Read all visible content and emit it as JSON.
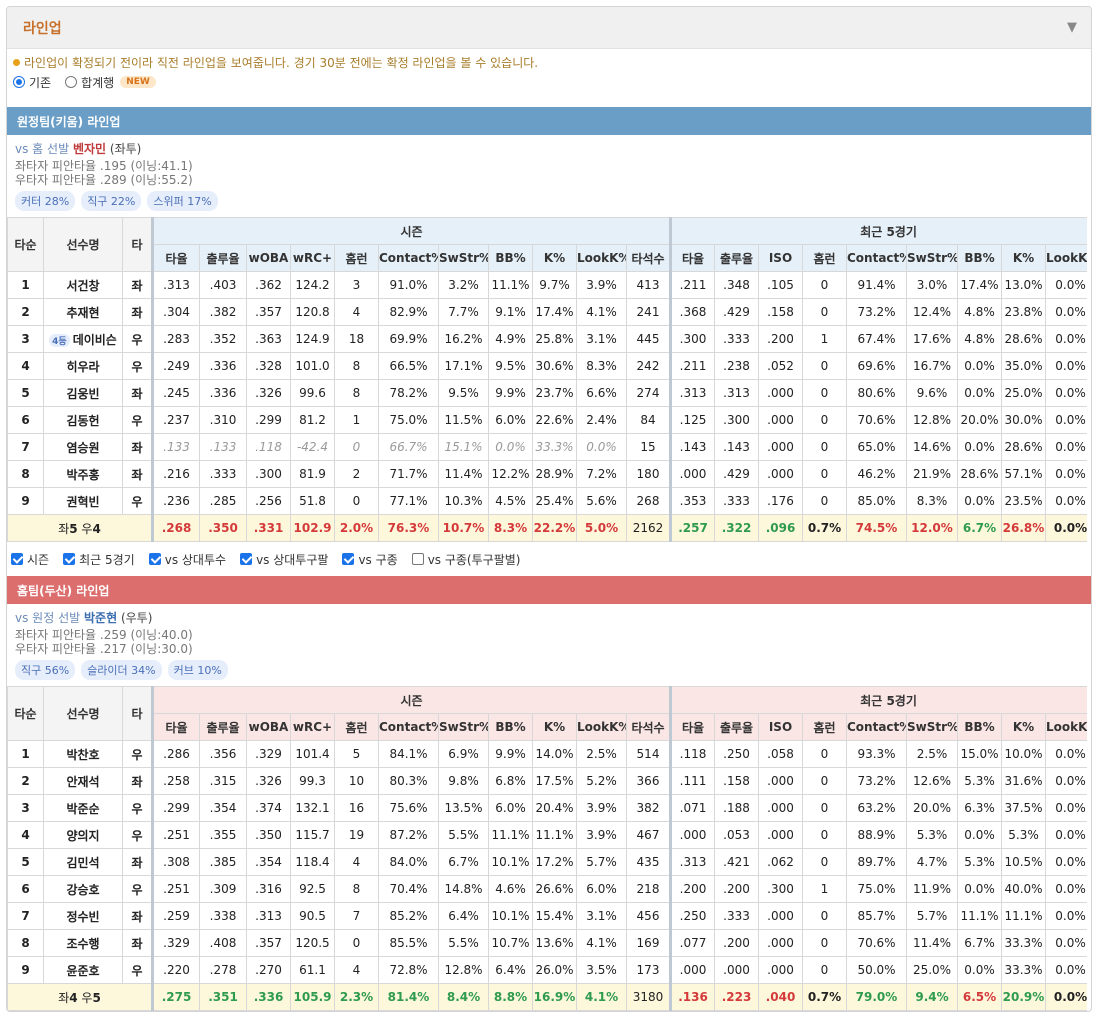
{
  "title": "라인업",
  "notice": "라인업이 확정되기 전이라 직전 라인업을 보여줍니다. 경기 30분 전에는 확정 라인업을 볼 수 있습니다.",
  "view_options": [
    {
      "label": "기존",
      "selected": true
    },
    {
      "label": "합계행",
      "selected": false
    }
  ],
  "new_badge": "NEW",
  "filters": [
    {
      "label": "시즌",
      "checked": true
    },
    {
      "label": "최근 5경기",
      "checked": true
    },
    {
      "label": "vs 상대투수",
      "checked": true
    },
    {
      "label": "vs 상대투구팔",
      "checked": true
    },
    {
      "label": "vs 구종",
      "checked": true
    },
    {
      "label": "vs 구종(투구팔별)",
      "checked": false
    }
  ],
  "headers": {
    "order": "타순",
    "name": "선수명",
    "hand": "타",
    "season": "시즌",
    "recent": "최근 5경기",
    "season_cols": [
      "타율",
      "출루율",
      "wOBA",
      "wRC+",
      "홈런",
      "Contact%",
      "SwStr%",
      "BB%",
      "K%",
      "LookK%",
      "타석수"
    ],
    "recent_cols": [
      "타율",
      "출루율",
      "ISO",
      "홈런",
      "Contact%",
      "SwStr%",
      "BB%",
      "K%",
      "LookK%"
    ]
  },
  "away": {
    "header": "원정팀(키움) 라인업",
    "vs_prefix": "vs 홈 선발",
    "pitcher": "벤자민",
    "pitcher_hand": "(좌투)",
    "vs_left": "좌타자 피안타율 .195 (이닝:41.1)",
    "vs_right": "우타자 피안타율 .289 (이닝:55.2)",
    "pitches": [
      "커터 28%",
      "직구 22%",
      "스위퍼 17%"
    ],
    "rows": [
      {
        "order": "1",
        "name": "서건창",
        "badge": "",
        "hand": "좌",
        "dim": false,
        "s": [
          ".313",
          ".403",
          ".362",
          "124.2",
          "3",
          "91.0%",
          "3.2%",
          "11.1%",
          "9.7%",
          "3.9%",
          "413"
        ],
        "r": [
          ".211",
          ".348",
          ".105",
          "0",
          "91.4%",
          "3.0%",
          "17.4%",
          "13.0%",
          "0.0%"
        ]
      },
      {
        "order": "2",
        "name": "추재현",
        "badge": "",
        "hand": "좌",
        "dim": false,
        "s": [
          ".304",
          ".382",
          ".357",
          "120.8",
          "4",
          "82.9%",
          "7.7%",
          "9.1%",
          "17.4%",
          "4.1%",
          "241"
        ],
        "r": [
          ".368",
          ".429",
          ".158",
          "0",
          "73.2%",
          "12.4%",
          "4.8%",
          "23.8%",
          "0.0%"
        ]
      },
      {
        "order": "3",
        "name": "데이비슨",
        "badge": "4등",
        "hand": "우",
        "dim": false,
        "s": [
          ".283",
          ".352",
          ".363",
          "124.9",
          "18",
          "69.9%",
          "16.2%",
          "4.9%",
          "25.8%",
          "3.1%",
          "445"
        ],
        "r": [
          ".300",
          ".333",
          ".200",
          "1",
          "67.4%",
          "17.6%",
          "4.8%",
          "28.6%",
          "0.0%"
        ]
      },
      {
        "order": "4",
        "name": "히우라",
        "badge": "",
        "hand": "우",
        "dim": false,
        "s": [
          ".249",
          ".336",
          ".328",
          "101.0",
          "8",
          "66.5%",
          "17.1%",
          "9.5%",
          "30.6%",
          "8.3%",
          "242"
        ],
        "r": [
          ".211",
          ".238",
          ".052",
          "0",
          "69.6%",
          "16.7%",
          "0.0%",
          "35.0%",
          "0.0%"
        ]
      },
      {
        "order": "5",
        "name": "김웅빈",
        "badge": "",
        "hand": "좌",
        "dim": false,
        "s": [
          ".245",
          ".336",
          ".326",
          "99.6",
          "8",
          "78.2%",
          "9.5%",
          "9.9%",
          "23.7%",
          "6.6%",
          "274"
        ],
        "r": [
          ".313",
          ".313",
          ".000",
          "0",
          "80.6%",
          "9.6%",
          "0.0%",
          "25.0%",
          "0.0%"
        ]
      },
      {
        "order": "6",
        "name": "김동헌",
        "badge": "",
        "hand": "우",
        "dim": false,
        "s": [
          ".237",
          ".310",
          ".299",
          "81.2",
          "1",
          "75.0%",
          "11.5%",
          "6.0%",
          "22.6%",
          "2.4%",
          "84"
        ],
        "r": [
          ".125",
          ".300",
          ".000",
          "0",
          "70.6%",
          "12.8%",
          "20.0%",
          "30.0%",
          "0.0%"
        ]
      },
      {
        "order": "7",
        "name": "염승원",
        "badge": "",
        "hand": "좌",
        "dim": true,
        "s": [
          ".133",
          ".133",
          ".118",
          "-42.4",
          "0",
          "66.7%",
          "15.1%",
          "0.0%",
          "33.3%",
          "0.0%",
          "15"
        ],
        "r": [
          ".143",
          ".143",
          ".000",
          "0",
          "65.0%",
          "14.6%",
          "0.0%",
          "28.6%",
          "0.0%"
        ]
      },
      {
        "order": "8",
        "name": "박주홍",
        "badge": "",
        "hand": "좌",
        "dim": false,
        "s": [
          ".216",
          ".333",
          ".300",
          "81.9",
          "2",
          "71.7%",
          "11.4%",
          "12.2%",
          "28.9%",
          "7.2%",
          "180"
        ],
        "r": [
          ".000",
          ".429",
          ".000",
          "0",
          "46.2%",
          "21.9%",
          "28.6%",
          "57.1%",
          "0.0%"
        ]
      },
      {
        "order": "9",
        "name": "권혁빈",
        "badge": "",
        "hand": "우",
        "dim": false,
        "s": [
          ".236",
          ".285",
          ".256",
          "51.8",
          "0",
          "77.1%",
          "10.3%",
          "4.5%",
          "25.4%",
          "5.6%",
          "268"
        ],
        "r": [
          ".353",
          ".333",
          ".176",
          "0",
          "85.0%",
          "8.3%",
          "0.0%",
          "23.5%",
          "0.0%"
        ]
      }
    ],
    "total": {
      "pre": "좌",
      "l": "5",
      "mid": " 우",
      "rr": "4",
      "s": [
        ".268",
        ".350",
        ".331",
        "102.9",
        "2.0%",
        "76.3%",
        "10.7%",
        "8.3%",
        "22.2%",
        "5.0%",
        "2162"
      ],
      "r": [
        ".257",
        ".322",
        ".096",
        "0.7%",
        "74.5%",
        "12.0%",
        "6.7%",
        "26.8%",
        "0.0%"
      ],
      "sc": [
        "r",
        "r",
        "r",
        "r",
        "r",
        "r",
        "r",
        "r",
        "r",
        "r",
        ""
      ],
      "rc": [
        "g",
        "g",
        "g",
        "",
        "r",
        "r",
        "g",
        "r",
        ""
      ]
    }
  },
  "home": {
    "header": "홈팀(두산) 라인업",
    "vs_prefix": "vs 원정 선발",
    "pitcher": "박준현",
    "pitcher_hand": "(우투)",
    "vs_left": "좌타자 피안타율 .259 (이닝:40.0)",
    "vs_right": "우타자 피안타율 .217 (이닝:30.0)",
    "pitches": [
      "직구 56%",
      "슬라이더 34%",
      "커브 10%"
    ],
    "rows": [
      {
        "order": "1",
        "name": "박찬호",
        "badge": "",
        "hand": "우",
        "dim": false,
        "s": [
          ".286",
          ".356",
          ".329",
          "101.4",
          "5",
          "84.1%",
          "6.9%",
          "9.9%",
          "14.0%",
          "2.5%",
          "514"
        ],
        "r": [
          ".118",
          ".250",
          ".058",
          "0",
          "93.3%",
          "2.5%",
          "15.0%",
          "10.0%",
          "0.0%"
        ]
      },
      {
        "order": "2",
        "name": "안재석",
        "badge": "",
        "hand": "좌",
        "dim": false,
        "s": [
          ".258",
          ".315",
          ".326",
          "99.3",
          "10",
          "80.3%",
          "9.8%",
          "6.8%",
          "17.5%",
          "5.2%",
          "366"
        ],
        "r": [
          ".111",
          ".158",
          ".000",
          "0",
          "73.2%",
          "12.6%",
          "5.3%",
          "31.6%",
          "0.0%"
        ]
      },
      {
        "order": "3",
        "name": "박준순",
        "badge": "",
        "hand": "우",
        "dim": false,
        "s": [
          ".299",
          ".354",
          ".374",
          "132.1",
          "16",
          "75.6%",
          "13.5%",
          "6.0%",
          "20.4%",
          "3.9%",
          "382"
        ],
        "r": [
          ".071",
          ".188",
          ".000",
          "0",
          "63.2%",
          "20.0%",
          "6.3%",
          "37.5%",
          "0.0%"
        ]
      },
      {
        "order": "4",
        "name": "양의지",
        "badge": "",
        "hand": "우",
        "dim": false,
        "s": [
          ".251",
          ".355",
          ".350",
          "115.7",
          "19",
          "87.2%",
          "5.5%",
          "11.1%",
          "11.1%",
          "3.9%",
          "467"
        ],
        "r": [
          ".000",
          ".053",
          ".000",
          "0",
          "88.9%",
          "5.3%",
          "0.0%",
          "5.3%",
          "0.0%"
        ]
      },
      {
        "order": "5",
        "name": "김민석",
        "badge": "",
        "hand": "좌",
        "dim": false,
        "s": [
          ".308",
          ".385",
          ".354",
          "118.4",
          "4",
          "84.0%",
          "6.7%",
          "10.1%",
          "17.2%",
          "5.7%",
          "435"
        ],
        "r": [
          ".313",
          ".421",
          ".062",
          "0",
          "89.7%",
          "4.7%",
          "5.3%",
          "10.5%",
          "0.0%"
        ]
      },
      {
        "order": "6",
        "name": "강승호",
        "badge": "",
        "hand": "우",
        "dim": false,
        "s": [
          ".251",
          ".309",
          ".316",
          "92.5",
          "8",
          "70.4%",
          "14.8%",
          "4.6%",
          "26.6%",
          "6.0%",
          "218"
        ],
        "r": [
          ".200",
          ".200",
          ".300",
          "1",
          "75.0%",
          "11.9%",
          "0.0%",
          "40.0%",
          "0.0%"
        ]
      },
      {
        "order": "7",
        "name": "정수빈",
        "badge": "",
        "hand": "좌",
        "dim": false,
        "s": [
          ".259",
          ".338",
          ".313",
          "90.5",
          "7",
          "85.2%",
          "6.4%",
          "10.1%",
          "15.4%",
          "3.1%",
          "456"
        ],
        "r": [
          ".250",
          ".333",
          ".000",
          "0",
          "85.7%",
          "5.7%",
          "11.1%",
          "11.1%",
          "0.0%"
        ]
      },
      {
        "order": "8",
        "name": "조수행",
        "badge": "",
        "hand": "좌",
        "dim": false,
        "s": [
          ".329",
          ".408",
          ".357",
          "120.5",
          "0",
          "85.5%",
          "5.5%",
          "10.7%",
          "13.6%",
          "4.1%",
          "169"
        ],
        "r": [
          ".077",
          ".200",
          ".000",
          "0",
          "70.6%",
          "11.4%",
          "6.7%",
          "33.3%",
          "0.0%"
        ]
      },
      {
        "order": "9",
        "name": "윤준호",
        "badge": "",
        "hand": "우",
        "dim": false,
        "s": [
          ".220",
          ".278",
          ".270",
          "61.1",
          "4",
          "72.8%",
          "12.8%",
          "6.4%",
          "26.0%",
          "3.5%",
          "173"
        ],
        "r": [
          ".000",
          ".000",
          ".000",
          "0",
          "50.0%",
          "25.0%",
          "0.0%",
          "33.3%",
          "0.0%"
        ]
      }
    ],
    "total": {
      "pre": "좌",
      "l": "4",
      "mid": " 우",
      "rr": "5",
      "s": [
        ".275",
        ".351",
        ".336",
        "105.9",
        "2.3%",
        "81.4%",
        "8.4%",
        "8.8%",
        "16.9%",
        "4.1%",
        "3180"
      ],
      "r": [
        ".136",
        ".223",
        ".040",
        "0.7%",
        "79.0%",
        "9.4%",
        "6.5%",
        "20.9%",
        "0.0%"
      ],
      "sc": [
        "g",
        "g",
        "g",
        "g",
        "g",
        "g",
        "g",
        "g",
        "g",
        "g",
        ""
      ],
      "rc": [
        "r",
        "r",
        "r",
        "",
        "g",
        "g",
        "r",
        "g",
        ""
      ]
    }
  }
}
